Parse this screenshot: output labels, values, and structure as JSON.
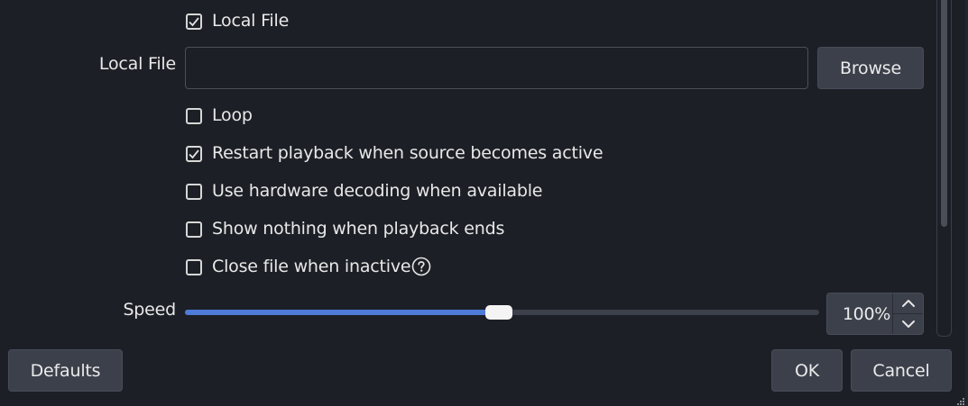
{
  "options": {
    "local_file_checkbox": {
      "label": "Local File",
      "checked": true
    },
    "local_file_field": {
      "label": "Local File",
      "value": "",
      "browse_label": "Browse"
    },
    "checkboxes": [
      {
        "label": "Loop",
        "checked": false
      },
      {
        "label": "Restart playback when source becomes active",
        "checked": true
      },
      {
        "label": "Use hardware decoding when available",
        "checked": false
      },
      {
        "label": "Show nothing when playback ends",
        "checked": false
      },
      {
        "label": "Close file when inactive",
        "checked": false,
        "help_icon": "question-circle-icon"
      }
    ],
    "speed": {
      "label": "Speed",
      "value_text": "100%",
      "slider_fraction": 0.495,
      "spin_up_icon": "chevron-up-icon",
      "spin_down_icon": "chevron-down-icon"
    }
  },
  "footer": {
    "defaults_label": "Defaults",
    "ok_label": "OK",
    "cancel_label": "Cancel"
  },
  "colors": {
    "background": "#1d1f26",
    "button": "#3c404b",
    "accent": "#4f7bd8",
    "text": "#e8e8e8"
  }
}
